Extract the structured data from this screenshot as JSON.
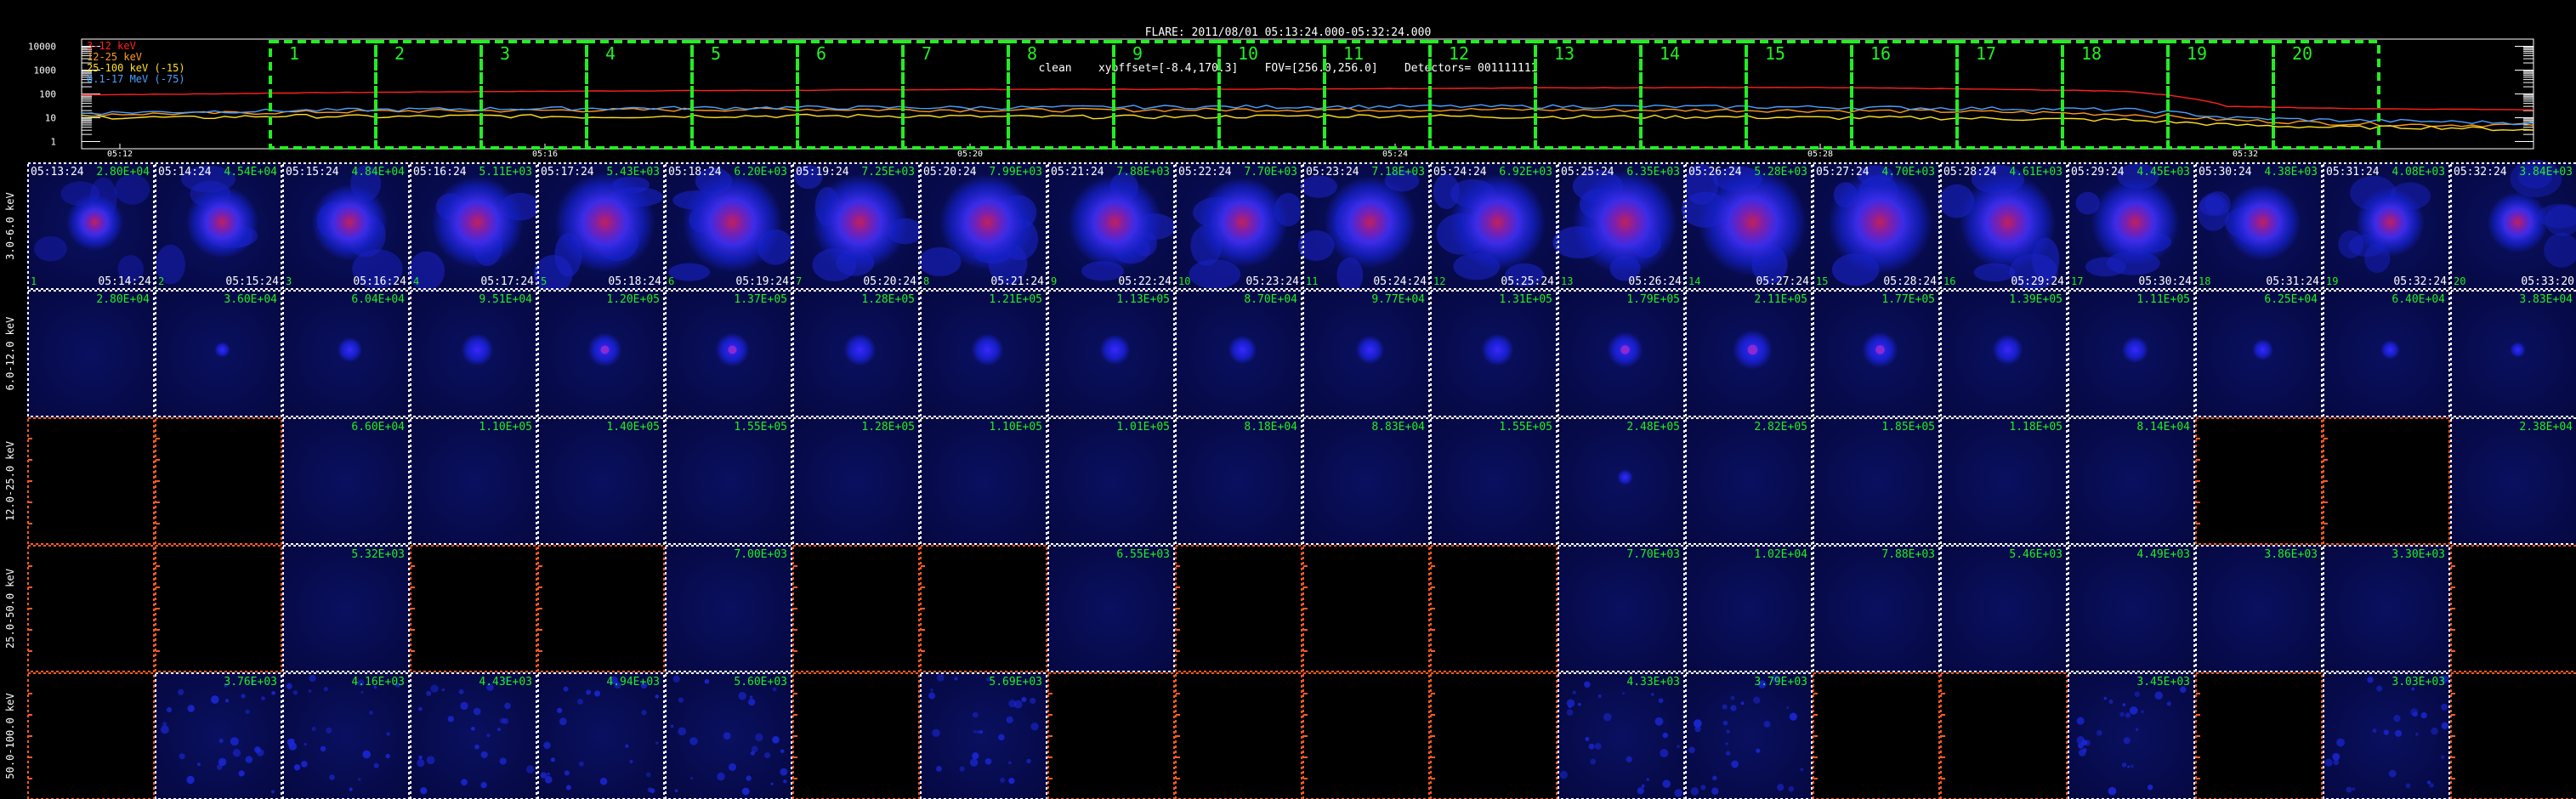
{
  "header": {
    "line1": "FLARE: 2011/08/01 05:13:24.000-05:32:24.000",
    "line2": "clean    xyoffset=[-8.4,170.3]    FOV=[256.0,256.0]    Detectors= 001111111"
  },
  "colors": {
    "background": "#000000",
    "grid_dashed": "#ffffff",
    "empty_panel_border": "#ff5a1e",
    "interval_box": "#22ee22",
    "panel_value_text": "#22ee22",
    "timestamp_text": "#ffffff",
    "image_bg": "#050840",
    "image_bg_light": "#0a1060",
    "blob_core": "#c0205c",
    "blob_mid": "#3a2ce8",
    "blob_outer": "#1420c8"
  },
  "chart_data": [
    {
      "type": "line",
      "title": "",
      "xlabel": "",
      "ylabel": "",
      "y_scale": "log",
      "ylim": [
        0.5,
        20000
      ],
      "y_ticks": [
        "10000",
        "1000",
        "100",
        "10",
        "1"
      ],
      "x_ticks": [
        "05:12",
        "05:16",
        "05:20",
        "05:24",
        "05:28",
        "05:32"
      ],
      "legend_position": "top-left",
      "legend": [
        {
          "label": "3-12 keV",
          "color": "#ff2020"
        },
        {
          "label": "12-25 keV",
          "color": "#ff9a20"
        },
        {
          "label": "25-100 keV (-15)",
          "color": "#ffe020"
        },
        {
          "label": "0.1-17 MeV (-75)",
          "color": "#4aa0ff"
        }
      ],
      "series": [
        {
          "name": "3-12 keV",
          "color": "#ff2020",
          "values": [
            92,
            98,
            110,
            118,
            126,
            132,
            138,
            142,
            150,
            155,
            156,
            158,
            162,
            170,
            178,
            182,
            186,
            184,
            170,
            150,
            130,
            30,
            25,
            23,
            22
          ]
        },
        {
          "name": "12-25 keV",
          "color": "#ff9a20",
          "values": [
            14,
            15,
            17,
            19,
            20,
            21,
            22,
            23,
            22,
            21,
            21,
            22,
            22,
            22,
            22,
            21,
            21,
            20,
            19,
            17,
            14,
            8,
            6,
            5,
            5
          ]
        },
        {
          "name": "25-100 keV (-15)",
          "color": "#ffe020",
          "values": [
            11,
            10,
            12,
            11,
            12,
            11,
            12,
            12,
            12,
            11,
            11,
            11,
            12,
            12,
            11,
            11,
            11,
            10,
            10,
            9,
            8,
            5,
            4,
            4,
            3
          ]
        },
        {
          "name": "0.1-17 MeV (-75)",
          "color": "#4aa0ff",
          "values": [
            16,
            18,
            20,
            22,
            24,
            25,
            26,
            27,
            27,
            27,
            28,
            29,
            29,
            30,
            30,
            30,
            29,
            28,
            26,
            24,
            22,
            10,
            8,
            7,
            6
          ]
        }
      ],
      "intervals": [
        "1",
        "2",
        "3",
        "4",
        "5",
        "6",
        "7",
        "8",
        "9",
        "10",
        "11",
        "12",
        "13",
        "14",
        "15",
        "16",
        "17",
        "18",
        "19",
        "20"
      ]
    },
    {
      "type": "heatmap",
      "rows": [
        {
          "label": "3.0-6.0 keV",
          "cells": [
            {
              "value": "2.80E+04",
              "empty": false,
              "intensity": 0.25,
              "t_start": "05:13:24",
              "t_end": "05:14:24",
              "index": "1"
            },
            {
              "value": "4.54E+04",
              "empty": false,
              "intensity": 0.45,
              "t_start": "05:14:24",
              "t_end": "05:15:24",
              "index": "2"
            },
            {
              "value": "4.84E+04",
              "empty": false,
              "intensity": 0.5,
              "t_start": "05:15:24",
              "t_end": "05:16:24",
              "index": "3"
            },
            {
              "value": "5.11E+03",
              "empty": false,
              "intensity": 0.7,
              "t_start": "05:16:24",
              "t_end": "05:17:24",
              "index": "4"
            },
            {
              "value": "5.43E+03",
              "empty": false,
              "intensity": 0.8,
              "t_start": "05:17:24",
              "t_end": "05:18:24",
              "index": "5"
            },
            {
              "value": "6.20E+03",
              "empty": false,
              "intensity": 0.8,
              "t_start": "05:18:24",
              "t_end": "05:19:24",
              "index": "6"
            },
            {
              "value": "7.25E+03",
              "empty": false,
              "intensity": 0.75,
              "t_start": "05:19:24",
              "t_end": "05:20:24",
              "index": "7"
            },
            {
              "value": "7.99E+03",
              "empty": false,
              "intensity": 0.75,
              "t_start": "05:20:24",
              "t_end": "05:21:24",
              "index": "8"
            },
            {
              "value": "7.88E+03",
              "empty": false,
              "intensity": 0.72,
              "t_start": "05:21:24",
              "t_end": "05:22:24",
              "index": "9"
            },
            {
              "value": "7.70E+03",
              "empty": false,
              "intensity": 0.68,
              "t_start": "05:22:24",
              "t_end": "05:23:24",
              "index": "10"
            },
            {
              "value": "7.18E+03",
              "empty": false,
              "intensity": 0.7,
              "t_start": "05:23:24",
              "t_end": "05:24:24",
              "index": "11"
            },
            {
              "value": "6.92E+03",
              "empty": false,
              "intensity": 0.75,
              "t_start": "05:24:24",
              "t_end": "05:25:24",
              "index": "12"
            },
            {
              "value": "6.35E+03",
              "empty": false,
              "intensity": 0.85,
              "t_start": "05:25:24",
              "t_end": "05:26:24",
              "index": "13"
            },
            {
              "value": "5.28E+03",
              "empty": false,
              "intensity": 0.9,
              "t_start": "05:26:24",
              "t_end": "05:27:24",
              "index": "14"
            },
            {
              "value": "4.70E+03",
              "empty": false,
              "intensity": 0.85,
              "t_start": "05:27:24",
              "t_end": "05:28:24",
              "index": "15"
            },
            {
              "value": "4.61E+03",
              "empty": false,
              "intensity": 0.75,
              "t_start": "05:28:24",
              "t_end": "05:29:24",
              "index": "16"
            },
            {
              "value": "4.45E+03",
              "empty": false,
              "intensity": 0.65,
              "t_start": "05:29:24",
              "t_end": "05:30:24",
              "index": "17"
            },
            {
              "value": "4.38E+03",
              "empty": false,
              "intensity": 0.5,
              "t_start": "05:30:24",
              "t_end": "05:31:24",
              "index": "18"
            },
            {
              "value": "4.08E+03",
              "empty": false,
              "intensity": 0.4,
              "t_start": "05:31:24",
              "t_end": "05:32:24",
              "index": "19"
            },
            {
              "value": "3.84E+03",
              "empty": false,
              "intensity": 0.3,
              "t_start": "05:32:24",
              "t_end": "05:33:20",
              "index": "20"
            }
          ]
        },
        {
          "label": "6.0-12.0 keV",
          "cells": [
            {
              "value": "2.80E+04",
              "empty": false,
              "intensity": 0.0
            },
            {
              "value": "3.60E+04",
              "empty": false,
              "intensity": 0.05
            },
            {
              "value": "6.04E+04",
              "empty": false,
              "intensity": 0.3
            },
            {
              "value": "9.51E+04",
              "empty": false,
              "intensity": 0.5
            },
            {
              "value": "1.20E+05",
              "empty": false,
              "intensity": 0.55
            },
            {
              "value": "1.37E+05",
              "empty": false,
              "intensity": 0.55
            },
            {
              "value": "1.28E+05",
              "empty": false,
              "intensity": 0.5
            },
            {
              "value": "1.21E+05",
              "empty": false,
              "intensity": 0.5
            },
            {
              "value": "1.13E+05",
              "empty": false,
              "intensity": 0.45
            },
            {
              "value": "8.70E+04",
              "empty": false,
              "intensity": 0.4
            },
            {
              "value": "9.77E+04",
              "empty": false,
              "intensity": 0.4
            },
            {
              "value": "1.31E+05",
              "empty": false,
              "intensity": 0.5
            },
            {
              "value": "1.79E+05",
              "empty": false,
              "intensity": 0.6
            },
            {
              "value": "2.11E+05",
              "empty": false,
              "intensity": 0.7
            },
            {
              "value": "1.77E+05",
              "empty": false,
              "intensity": 0.6
            },
            {
              "value": "1.39E+05",
              "empty": false,
              "intensity": 0.45
            },
            {
              "value": "1.11E+05",
              "empty": false,
              "intensity": 0.35
            },
            {
              "value": "6.25E+04",
              "empty": false,
              "intensity": 0.2
            },
            {
              "value": "6.40E+04",
              "empty": false,
              "intensity": 0.15
            },
            {
              "value": "3.83E+04",
              "empty": false,
              "intensity": 0.05
            }
          ]
        },
        {
          "label": "12.0-25.0 keV",
          "cells": [
            {
              "value": "",
              "empty": true,
              "intensity": 0
            },
            {
              "value": "",
              "empty": true,
              "intensity": 0
            },
            {
              "value": "6.60E+04",
              "empty": false,
              "intensity": 0.0
            },
            {
              "value": "1.10E+05",
              "empty": false,
              "intensity": 0.0
            },
            {
              "value": "1.40E+05",
              "empty": false,
              "intensity": 0.0
            },
            {
              "value": "1.55E+05",
              "empty": false,
              "intensity": 0.0
            },
            {
              "value": "1.28E+05",
              "empty": false,
              "intensity": 0.0
            },
            {
              "value": "1.10E+05",
              "empty": false,
              "intensity": 0.0
            },
            {
              "value": "1.01E+05",
              "empty": false,
              "intensity": 0.0
            },
            {
              "value": "8.18E+04",
              "empty": false,
              "intensity": 0.0
            },
            {
              "value": "8.83E+04",
              "empty": false,
              "intensity": 0.0
            },
            {
              "value": "1.55E+05",
              "empty": false,
              "intensity": 0.0
            },
            {
              "value": "2.48E+05",
              "empty": false,
              "intensity": 0.05
            },
            {
              "value": "2.82E+05",
              "empty": false,
              "intensity": 0.0
            },
            {
              "value": "1.85E+05",
              "empty": false,
              "intensity": 0.0
            },
            {
              "value": "1.18E+05",
              "empty": false,
              "intensity": 0.0
            },
            {
              "value": "8.14E+04",
              "empty": false,
              "intensity": 0.0
            },
            {
              "value": "",
              "empty": true,
              "intensity": 0
            },
            {
              "value": "",
              "empty": true,
              "intensity": 0
            },
            {
              "value": "2.38E+04",
              "empty": false,
              "intensity": 0.0
            }
          ]
        },
        {
          "label": "25.0-50.0 keV",
          "cells": [
            {
              "value": "",
              "empty": true,
              "intensity": 0
            },
            {
              "value": "",
              "empty": true,
              "intensity": 0
            },
            {
              "value": "5.32E+03",
              "empty": false,
              "intensity": 0.0
            },
            {
              "value": "",
              "empty": true,
              "intensity": 0
            },
            {
              "value": "",
              "empty": true,
              "intensity": 0
            },
            {
              "value": "7.00E+03",
              "empty": false,
              "intensity": 0.0
            },
            {
              "value": "",
              "empty": true,
              "intensity": 0
            },
            {
              "value": "",
              "empty": true,
              "intensity": 0
            },
            {
              "value": "6.55E+03",
              "empty": false,
              "intensity": 0.0
            },
            {
              "value": "",
              "empty": true,
              "intensity": 0
            },
            {
              "value": "",
              "empty": true,
              "intensity": 0
            },
            {
              "value": "",
              "empty": true,
              "intensity": 0
            },
            {
              "value": "7.70E+03",
              "empty": false,
              "intensity": 0.0
            },
            {
              "value": "1.02E+04",
              "empty": false,
              "intensity": 0.0
            },
            {
              "value": "7.88E+03",
              "empty": false,
              "intensity": 0.0
            },
            {
              "value": "5.46E+03",
              "empty": false,
              "intensity": 0.0
            },
            {
              "value": "4.49E+03",
              "empty": false,
              "intensity": 0.0
            },
            {
              "value": "3.86E+03",
              "empty": false,
              "intensity": 0.0
            },
            {
              "value": "3.30E+03",
              "empty": false,
              "intensity": 0.0
            },
            {
              "value": "",
              "empty": true,
              "intensity": 0
            }
          ]
        },
        {
          "label": "50.0-100.0 keV",
          "cells": [
            {
              "value": "",
              "empty": true,
              "intensity": 0
            },
            {
              "value": "3.76E+03",
              "empty": false,
              "intensity": 0.0,
              "noisy": true
            },
            {
              "value": "4.16E+03",
              "empty": false,
              "intensity": 0.0,
              "noisy": true
            },
            {
              "value": "4.43E+03",
              "empty": false,
              "intensity": 0.0,
              "noisy": true
            },
            {
              "value": "4.94E+03",
              "empty": false,
              "intensity": 0.0,
              "noisy": true
            },
            {
              "value": "5.60E+03",
              "empty": false,
              "intensity": 0.0,
              "noisy": true
            },
            {
              "value": "",
              "empty": true,
              "intensity": 0
            },
            {
              "value": "5.69E+03",
              "empty": false,
              "intensity": 0.0,
              "noisy": true
            },
            {
              "value": "",
              "empty": true,
              "intensity": 0
            },
            {
              "value": "",
              "empty": true,
              "intensity": 0
            },
            {
              "value": "",
              "empty": true,
              "intensity": 0
            },
            {
              "value": "",
              "empty": true,
              "intensity": 0
            },
            {
              "value": "4.33E+03",
              "empty": false,
              "intensity": 0.0,
              "noisy": true
            },
            {
              "value": "3.79E+03",
              "empty": false,
              "intensity": 0.0,
              "noisy": true
            },
            {
              "value": "",
              "empty": true,
              "intensity": 0
            },
            {
              "value": "",
              "empty": true,
              "intensity": 0
            },
            {
              "value": "3.45E+03",
              "empty": false,
              "intensity": 0.0,
              "noisy": true
            },
            {
              "value": "",
              "empty": true,
              "intensity": 0
            },
            {
              "value": "3.03E+03",
              "empty": false,
              "intensity": 0.0,
              "noisy": true
            },
            {
              "value": "",
              "empty": true,
              "intensity": 0
            }
          ]
        }
      ]
    }
  ]
}
